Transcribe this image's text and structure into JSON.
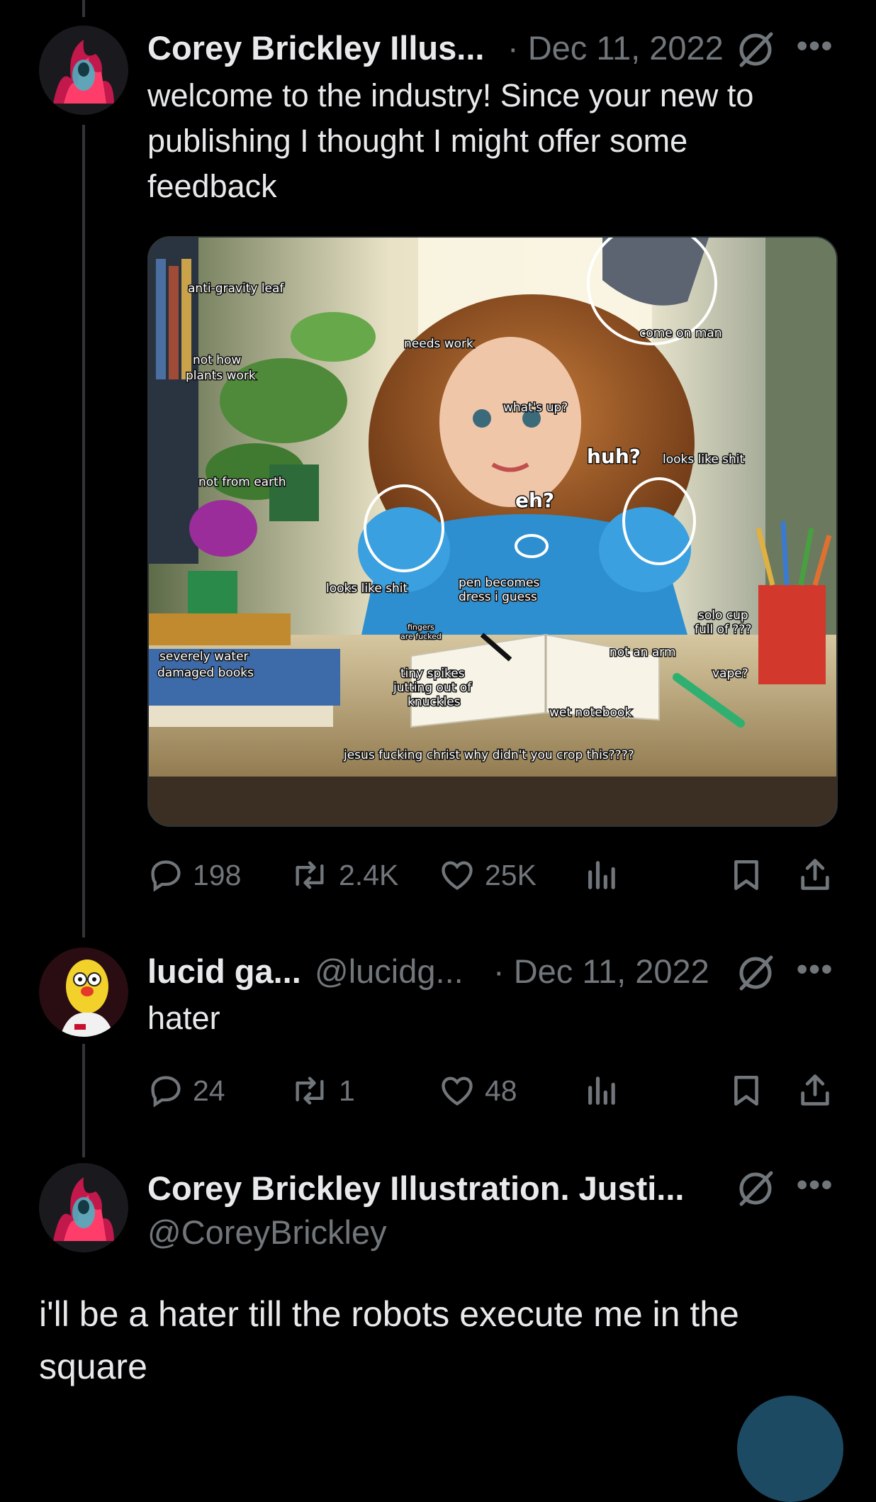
{
  "tweet1": {
    "author": "Corey Brickley Illus...",
    "date": "· Dec 11, 2022",
    "text_line1": "welcome to the industry! Since your new to",
    "text_line2": "publishing I thought I might offer some",
    "text_line3": "feedback",
    "media_annotations": {
      "a1": "anti-gravity leaf",
      "a2": "not how",
      "a3": "plants work",
      "a4": "needs work",
      "a5": "come on man",
      "a6": "what's up?",
      "a7": "huh?",
      "a8": "looks like shit",
      "a9": "not from earth",
      "a10": "eh?",
      "a11": "looks like shit",
      "a12": "pen becomes",
      "a13": "dress i guess",
      "a14": "solo cup",
      "a15": "full of ???",
      "a16": "fingers",
      "a17": "are fucked",
      "a18": "severely water",
      "a19": "damaged books",
      "a20": "not an arm",
      "a21": "tiny spikes",
      "a22": "jutting out of",
      "a23": "knuckles",
      "a24": "vape?",
      "a25": "wet notebook",
      "a26": "jesus fucking christ why didn't you crop this????"
    },
    "replies": "198",
    "reposts": "2.4K",
    "likes": "25K"
  },
  "tweet2": {
    "author": "lucid ga...",
    "handle": "@lucidg...",
    "date": "· Dec 11, 2022",
    "text": "hater",
    "replies": "24",
    "reposts": "1",
    "likes": "48"
  },
  "tweet3": {
    "author": "Corey Brickley Illustration. Justi...",
    "handle": "@CoreyBrickley",
    "text_line1": "i'll be a hater till the robots execute me in the",
    "text_line2": "square"
  },
  "icons": {
    "reply": "reply-icon",
    "repost": "repost-icon",
    "like": "heart-icon",
    "views": "views-icon",
    "bookmark": "bookmark-icon",
    "share": "share-icon",
    "mute": "muted-icon",
    "more": "more-icon"
  },
  "colors": {
    "background": "#000000",
    "text": "#e7e9ea",
    "muted": "#71767b",
    "line": "#333639",
    "accent": "#1d9bf0"
  }
}
